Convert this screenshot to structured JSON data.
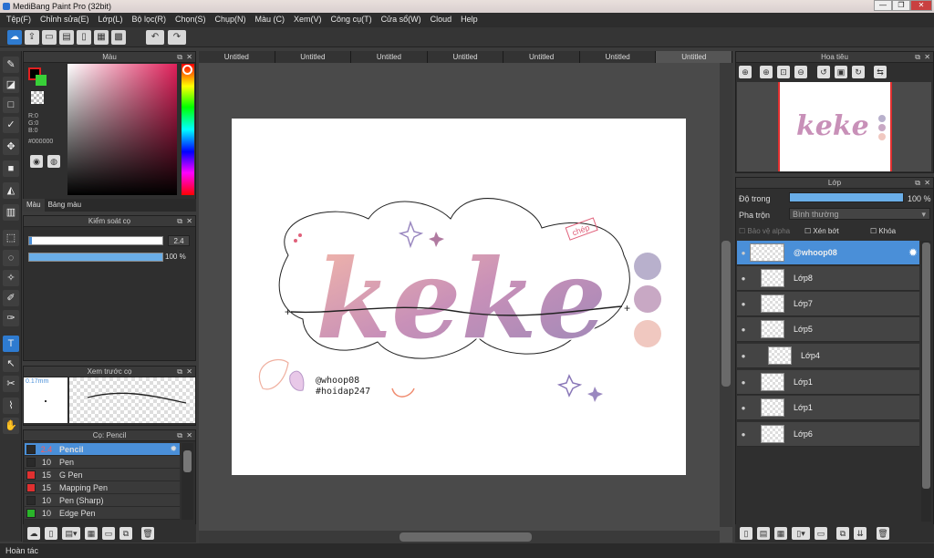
{
  "window": {
    "title": "MediBang Paint Pro (32bit)",
    "min": "—",
    "max": "❐",
    "close": "✕"
  },
  "menu": [
    "Tệp(F)",
    "Chỉnh sửa(E)",
    "Lớp(L)",
    "Bộ lọc(R)",
    "Chọn(S)",
    "Chụp(N)",
    "Màu (C)",
    "Xem(V)",
    "Công cụ(T)",
    "Cửa sổ(W)",
    "Cloud",
    "Help"
  ],
  "color_panel": {
    "title": "Màu",
    "r": "R:0",
    "g": "G:0",
    "b": "B:0",
    "hex": "#000000",
    "tab_color": "Màu",
    "tab_palette": "Bảng màu"
  },
  "brush_control": {
    "title": "Kiểm soát cọ",
    "size": "2.4",
    "opacity": "100 %",
    "opacity_value": 1.0
  },
  "brush_preview": {
    "title": "Xem trước cọ",
    "size_label": "0.17mm"
  },
  "brush_list": {
    "title": "Cọ: Pencil",
    "items": [
      {
        "size": "2.4",
        "name": "Pencil",
        "color": "#2a2a2a"
      },
      {
        "size": "10",
        "name": "Pen",
        "color": "#2a2a2a"
      },
      {
        "size": "15",
        "name": "G Pen",
        "color": "#e03030"
      },
      {
        "size": "15",
        "name": "Mapping Pen",
        "color": "#e03030"
      },
      {
        "size": "10",
        "name": "Pen (Sharp)",
        "color": "#2a2a2a"
      },
      {
        "size": "10",
        "name": "Edge Pen",
        "color": "#2ab52a"
      }
    ]
  },
  "tabs": [
    "Untitled",
    "Untitled",
    "Untitled",
    "Untitled",
    "Untitled",
    "Untitled",
    "Untitled"
  ],
  "artwork": {
    "word": "keke",
    "handle": "@whoop08",
    "tag": "#hoidap247",
    "stamp": "chép",
    "swatches": [
      "#b8b0cc",
      "#c8a8c4",
      "#f0c8c0"
    ]
  },
  "navigator": {
    "title": "Hoa tiêu"
  },
  "layers": {
    "title": "Lớp",
    "opacity_label": "Độ trong",
    "opacity": "100 %",
    "blend_label": "Pha trộn",
    "blend": "Bình thường",
    "alpha_protect": "Bảo vệ alpha",
    "clip": "Xén bớt",
    "lock": "Khóa",
    "items": [
      "@whoop08",
      "Lớp8",
      "Lớp7",
      "Lớp5",
      "Lớp4",
      "Lớp1",
      "Lớp1",
      "Lớp6"
    ]
  },
  "status": "Hoàn tác",
  "accent": "#4a8fd8"
}
